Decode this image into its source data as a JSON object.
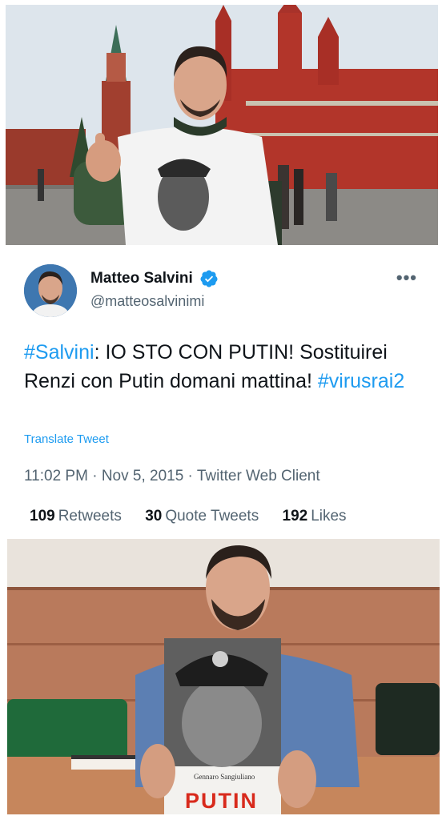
{
  "tweet": {
    "display_name": "Matteo Salvini",
    "handle": "@matteosalvinimi",
    "more_icon": "more-horizontal-icon",
    "verified_icon": "verified-badge-icon",
    "text": {
      "hashtag1": "#Salvini",
      "part1": ": IO STO CON PUTIN! Sostituirei Renzi con Putin domani mattina! ",
      "hashtag2": "#virusrai2"
    },
    "translate_label": "Translate Tweet",
    "time": "11:02 PM",
    "date": "Nov 5, 2015",
    "client": "Twitter Web Client",
    "separator": " · ",
    "stats": {
      "retweets_count": "109",
      "retweets_label": "Retweets",
      "quotes_count": "30",
      "quotes_label": "Quote Tweets",
      "likes_count": "192",
      "likes_label": "Likes"
    }
  },
  "bottom_photo": {
    "book_author": "Gennaro Sangiuliano",
    "book_title": "PUTIN"
  },
  "colors": {
    "accent": "#1d9bf0",
    "text_primary": "#0f1419",
    "text_secondary": "#536471"
  }
}
